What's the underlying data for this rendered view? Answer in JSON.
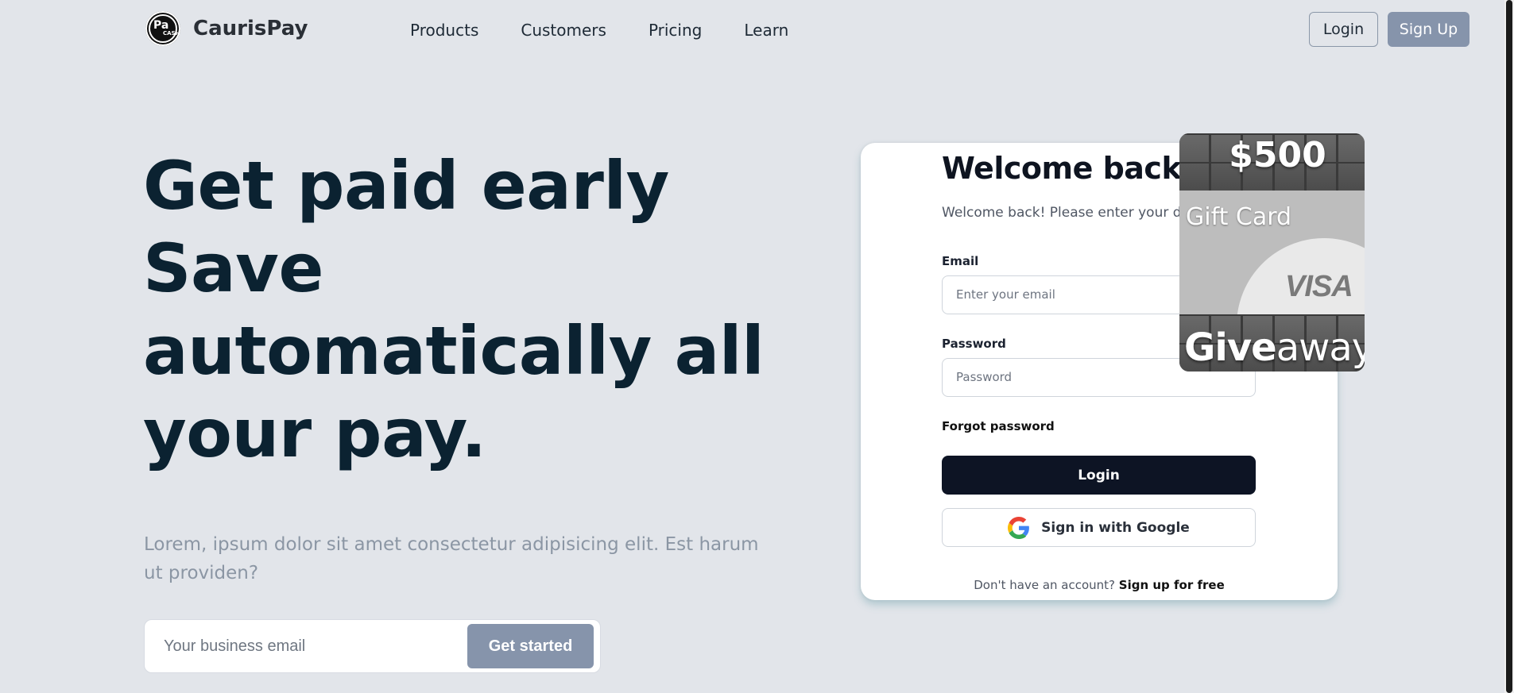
{
  "nav": {
    "brand": "CaurisPay",
    "logo_text_1": "Pa",
    "logo_text_2": "CASH",
    "links": [
      "Products",
      "Customers",
      "Pricing",
      "Learn"
    ],
    "login_label": "Login",
    "signup_label": "Sign Up"
  },
  "hero": {
    "title_lines": [
      "Get paid early",
      "Save",
      "automatically all",
      "your pay."
    ],
    "subtitle": "Lorem, ipsum dolor sit amet consectetur adipisicing elit. Est harum ut providen?",
    "email_placeholder": "Your business email",
    "cta_label": "Get started"
  },
  "login_card": {
    "title": "Welcome back",
    "subtitle": "Welcome back! Please enter your details.",
    "email_label": "Email",
    "email_placeholder": "Enter your email",
    "password_label": "Password",
    "password_placeholder": "Password",
    "forgot_label": "Forgot password",
    "login_button": "Login",
    "google_button": "Sign in with Google",
    "footer_text": "Don't have an account?",
    "footer_link": "Sign up for free"
  },
  "gift_ad": {
    "amount": "$500",
    "card_label": "Gift Card",
    "brand": "VISA",
    "give_bold": "Give",
    "give_rest": "away"
  },
  "colors": {
    "background": "#e2e5ea",
    "accent": "#8694ab",
    "dark_button": "#0d1424",
    "title": "#0b2231"
  }
}
